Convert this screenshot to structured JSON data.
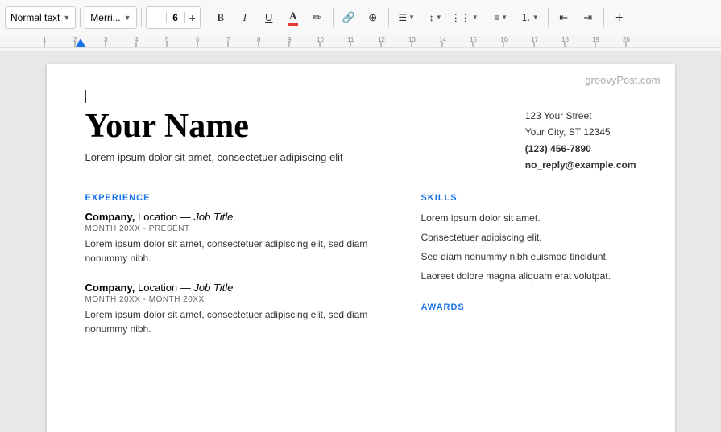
{
  "toolbar": {
    "style_label": "Normal text",
    "font_label": "Merri...",
    "font_size": "6",
    "bold_label": "B",
    "italic_label": "I",
    "underline_label": "U",
    "font_color_label": "A",
    "highlight_label": "✏",
    "link_label": "🔗",
    "insert_label": "⊕",
    "align_label": "≡",
    "spacing_label": "↕",
    "columns_label": "▤",
    "bullets_label": "☰",
    "numbered_label": "⒈",
    "decrease_indent_label": "◁",
    "increase_indent_label": "▷",
    "clear_label": "T̶",
    "minus_label": "—",
    "plus_label": "+"
  },
  "ruler": {
    "visible": true
  },
  "page": {
    "watermark": "groovyPost.com",
    "name": "Your Name",
    "tagline": "Lorem ipsum dolor sit amet, consectetuer adipiscing elit",
    "contact": {
      "street": "123 Your Street",
      "city": "Your City, ST 12345",
      "phone": "(123) 456-7890",
      "email": "no_reply@example.com"
    },
    "experience": {
      "section_title": "EXPERIENCE",
      "jobs": [
        {
          "company": "Company,",
          "location_title": " Location — ",
          "jobtitle": "Job Title",
          "date": "MONTH 20XX - PRESENT",
          "desc": "Lorem ipsum dolor sit amet, consectetuer adipiscing elit, sed diam nonummy nibh."
        },
        {
          "company": "Company,",
          "location_title": " Location — ",
          "jobtitle": "Job Title",
          "date": "MONTH 20XX - MONTH 20XX",
          "desc": "Lorem ipsum dolor sit amet, consectetuer adipiscing elit, sed diam nonummy nibh."
        }
      ]
    },
    "skills": {
      "section_title": "SKILLS",
      "items": [
        "Lorem ipsum dolor sit amet.",
        "Consectetuer adipiscing elit.",
        "Sed diam nonummy nibh euismod tincidunt.",
        "Laoreet dolore magna aliquam erat volutpat."
      ]
    },
    "awards": {
      "section_title": "AWARDS"
    }
  }
}
